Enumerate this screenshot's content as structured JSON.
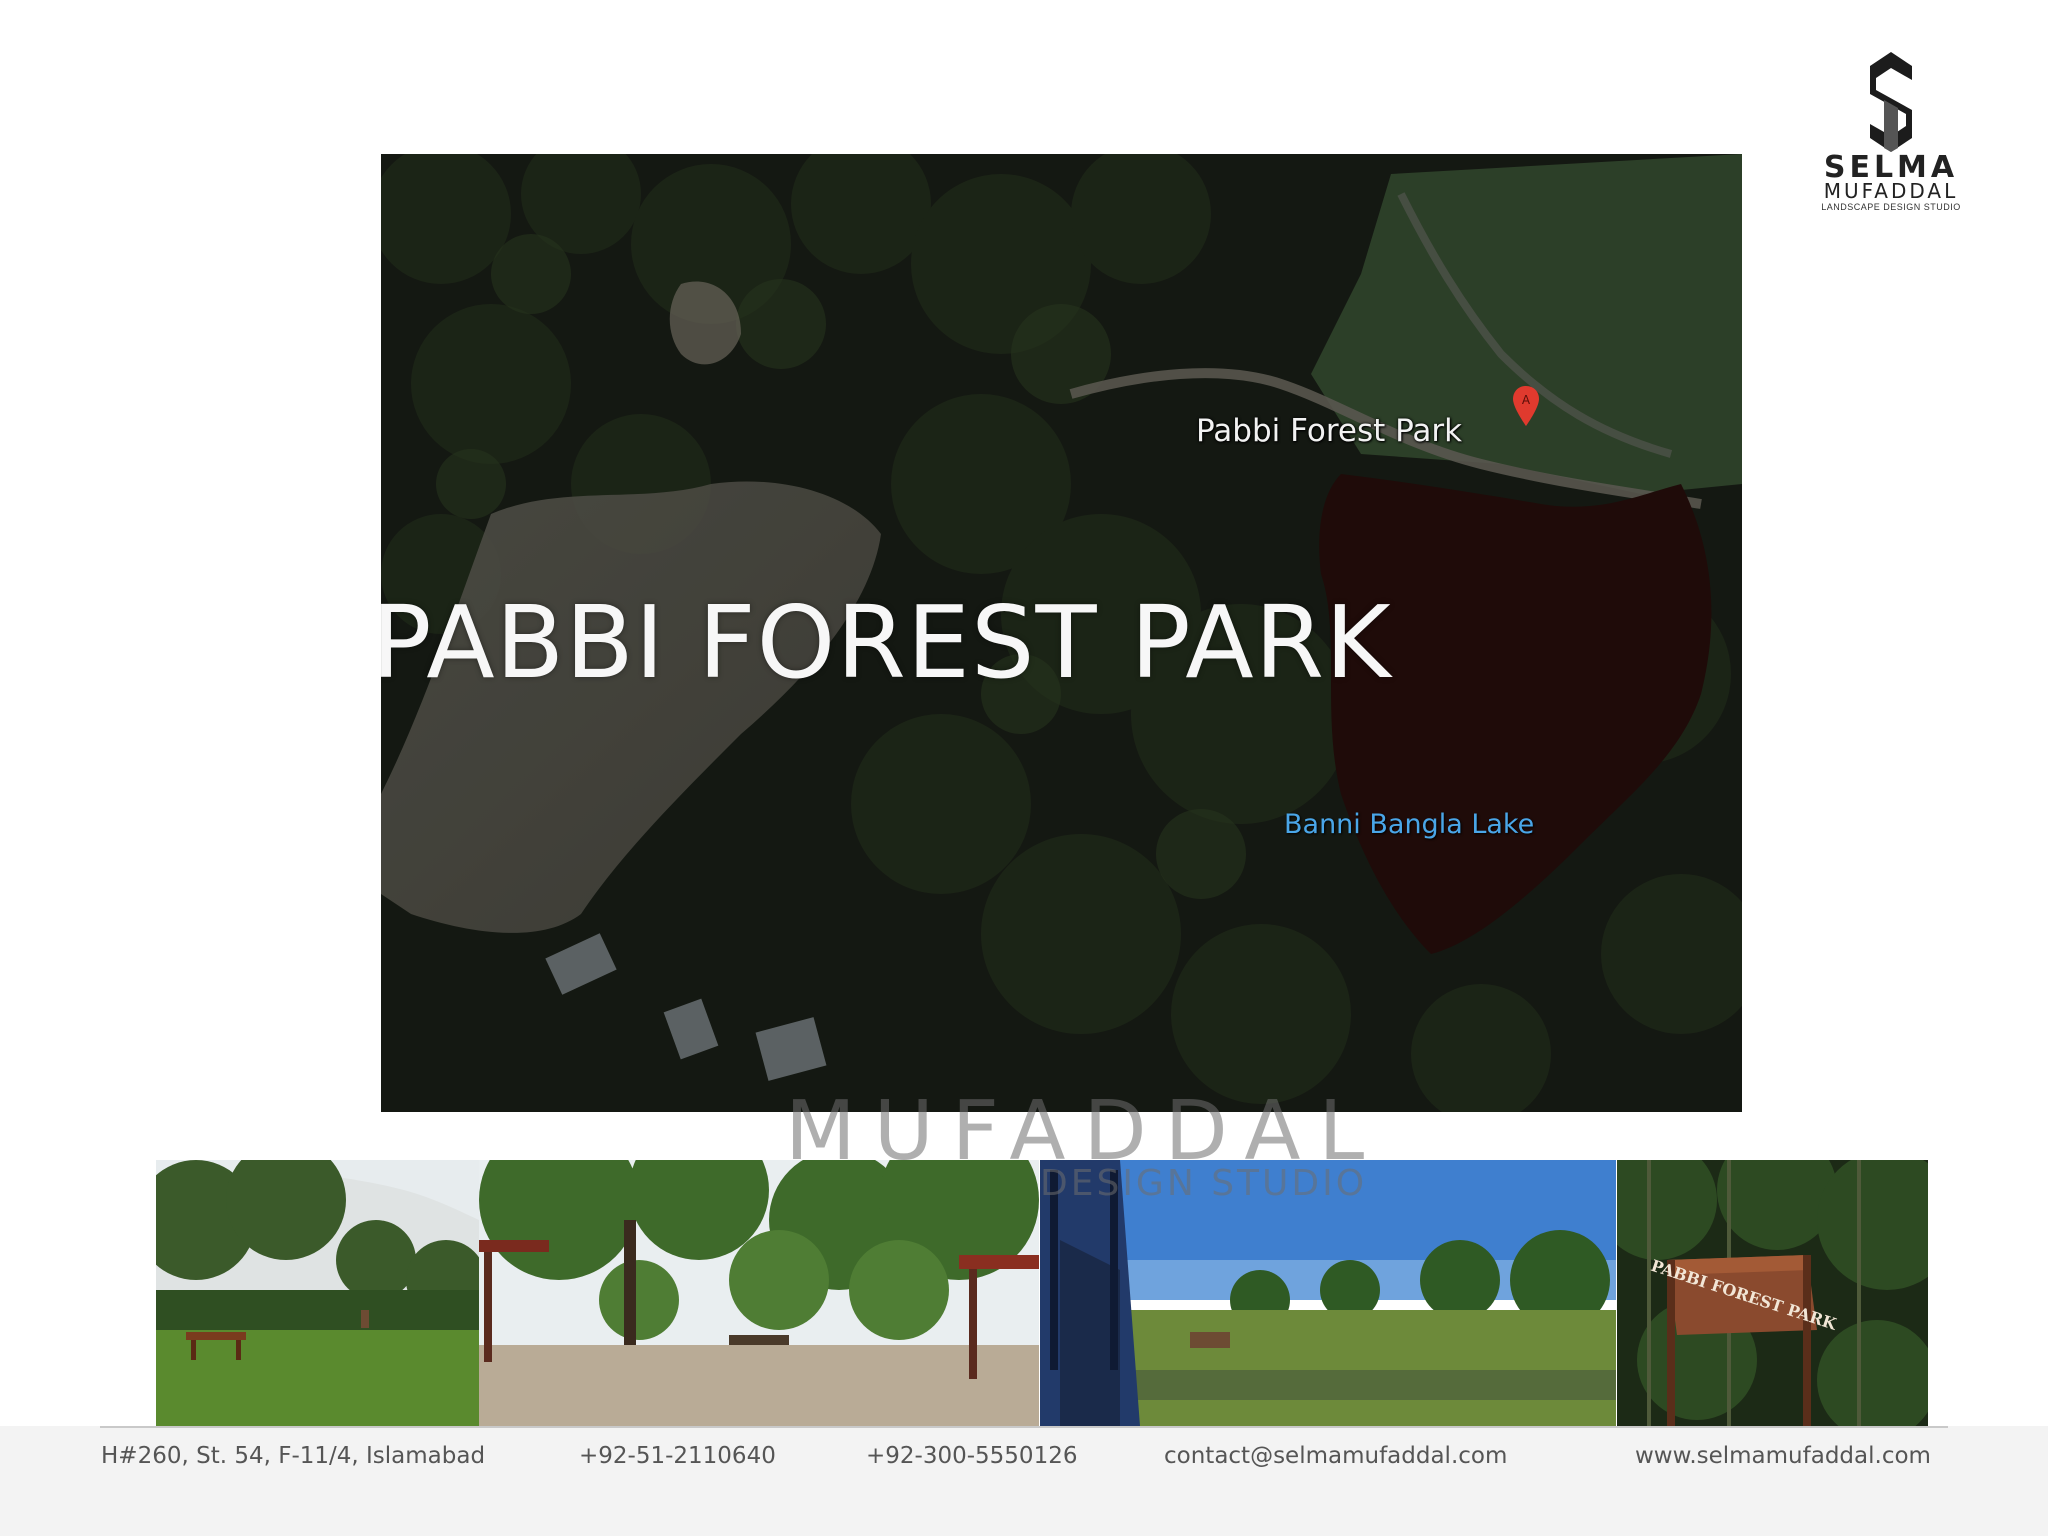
{
  "logo": {
    "word_line1": "SELMA",
    "word_line2": "MUFADDAL",
    "tagline": "LANDSCAPE DESIGN STUDIO"
  },
  "map": {
    "title": "PABBI FOREST PARK",
    "place_label": "Pabbi Forest Park",
    "pin_letter": "A",
    "lake_label": "Banni Bangla Lake"
  },
  "watermark": {
    "line2": "MUFADDAL",
    "line3": "DESIGN STUDIO"
  },
  "photo_sign": {
    "text": "PABBI FOREST PARK"
  },
  "footer": {
    "address": "H#260, St. 54, F-11/4, Islamabad",
    "phone1": "+92-51-2110640",
    "phone2": "+92-300-5550126",
    "email": "contact@selmamufaddal.com",
    "website": "www.selmamufaddal.com"
  },
  "colors": {
    "map_dark": "#1a1f17",
    "lake": "#2a0f0c",
    "lake_label": "#4aa6e8",
    "pin": "#e03a2e",
    "footer_bg": "#f3f3f3",
    "footer_text": "#555555"
  }
}
